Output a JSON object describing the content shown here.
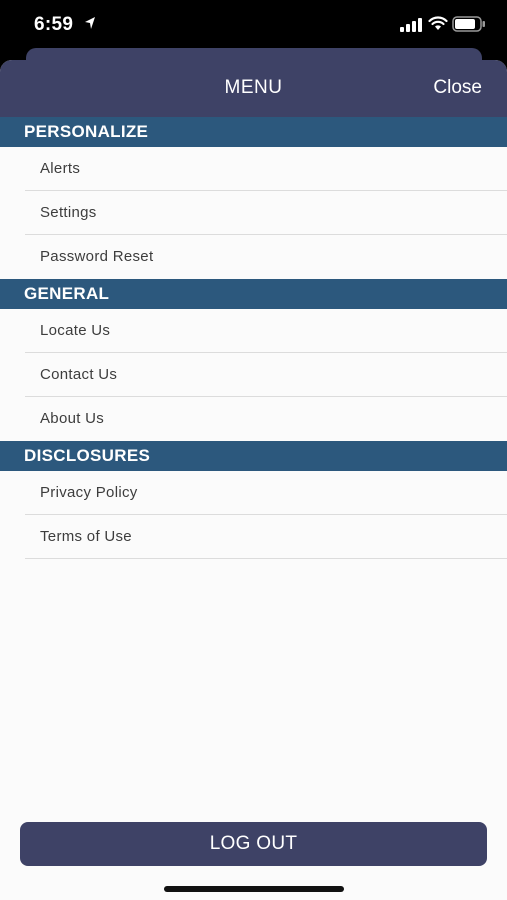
{
  "status": {
    "time": "6:59"
  },
  "header": {
    "title": "MENU",
    "close_label": "Close"
  },
  "sections": [
    {
      "title": "PERSONALIZE",
      "items": [
        "Alerts",
        "Settings",
        "Password Reset"
      ]
    },
    {
      "title": "GENERAL",
      "items": [
        "Locate Us",
        "Contact Us",
        "About Us"
      ]
    },
    {
      "title": "DISCLOSURES",
      "items": [
        "Privacy Policy",
        "Terms of Use"
      ]
    }
  ],
  "footer": {
    "logout_label": "LOG OUT"
  },
  "colors": {
    "header": "#3e4266",
    "section": "#2c587d",
    "background": "#fbfbfb"
  }
}
